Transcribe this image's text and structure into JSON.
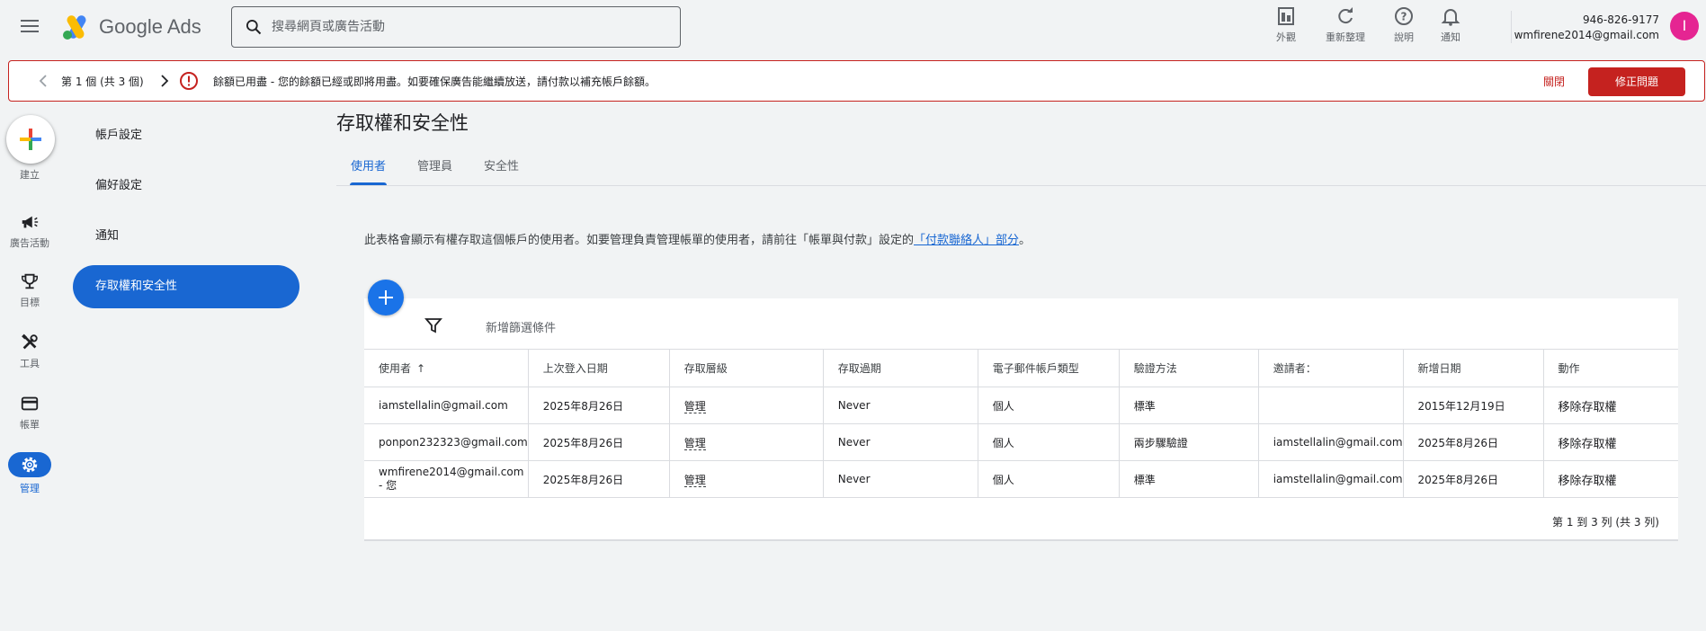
{
  "header": {
    "logo_text": "Google Ads",
    "search_placeholder": "搜尋網頁或廣告活動",
    "tools": [
      {
        "label": "外觀",
        "icon": "appearance-icon"
      },
      {
        "label": "重新整理",
        "icon": "refresh-icon"
      },
      {
        "label": "說明",
        "icon": "help-icon"
      },
      {
        "label": "通知",
        "icon": "bell-icon"
      }
    ],
    "account_id": "946-826-9177",
    "account_email": "wmfirene2014@gmail.com",
    "avatar_letter": "I",
    "avatar_color": "#e52592"
  },
  "alert": {
    "count_text": "第 1 個 (共 3 個)",
    "message": "餘額已用盡 - 您的餘額已經或即將用盡。如要確保廣告能繼續放送，請付款以補充帳戶餘額。",
    "dismiss_label": "關閉",
    "fix_label": "修正問題",
    "color": "#c5221f"
  },
  "rail": {
    "create_label": "建立",
    "items": [
      {
        "label": "廣告活動",
        "icon": "megaphone-icon"
      },
      {
        "label": "目標",
        "icon": "trophy-icon"
      },
      {
        "label": "工具",
        "icon": "tools-icon"
      },
      {
        "label": "帳單",
        "icon": "credit-card-icon"
      },
      {
        "label": "管理",
        "icon": "gear-icon"
      }
    ]
  },
  "side_nav": {
    "items": [
      "帳戶設定",
      "偏好設定",
      "通知",
      "存取權和安全性"
    ]
  },
  "main": {
    "title": "存取權和安全性",
    "tabs": [
      "使用者",
      "管理員",
      "安全性"
    ],
    "description_prefix": "此表格會顯示有權存取這個帳戶的使用者。如要管理負責管理帳單的使用者，請前往「帳單與付款」設定的",
    "description_link": "「付款聯絡人」部分",
    "description_suffix": "。",
    "filter_label": "新增篩選條件",
    "columns": [
      "使用者",
      "上次登入日期",
      "存取層級",
      "存取過期",
      "電子郵件帳戶類型",
      "驗證方法",
      "邀請者：",
      "新增日期",
      "動作"
    ],
    "sort_arrow": "↑",
    "rows": [
      {
        "user": "iamstellalin@gmail.com",
        "user_suffix": "",
        "last_login": "2025年8月26日",
        "access": "管理",
        "expiry": "Never",
        "email_type": "個人",
        "verification": "標準",
        "inviter": "",
        "added": "2015年12月19日",
        "action": "移除存取權"
      },
      {
        "user": "ponpon232323@gmail.com",
        "user_suffix": "",
        "last_login": "2025年8月26日",
        "access": "管理",
        "expiry": "Never",
        "email_type": "個人",
        "verification": "兩步驟驗證",
        "inviter": "iamstellalin@gmail.com",
        "added": "2025年8月26日",
        "action": "移除存取權"
      },
      {
        "user": "wmfirene2014@gmail.com",
        "user_suffix": "- 您",
        "last_login": "2025年8月26日",
        "access": "管理",
        "expiry": "Never",
        "email_type": "個人",
        "verification": "標準",
        "inviter": "iamstellalin@gmail.com",
        "added": "2025年8月26日",
        "action": "移除存取權"
      }
    ],
    "pager": "第 1 到 3 列 (共 3 列)"
  },
  "colors": {
    "accent": "#1967d2",
    "background": "#f1f3f4",
    "error": "#c5221f"
  }
}
